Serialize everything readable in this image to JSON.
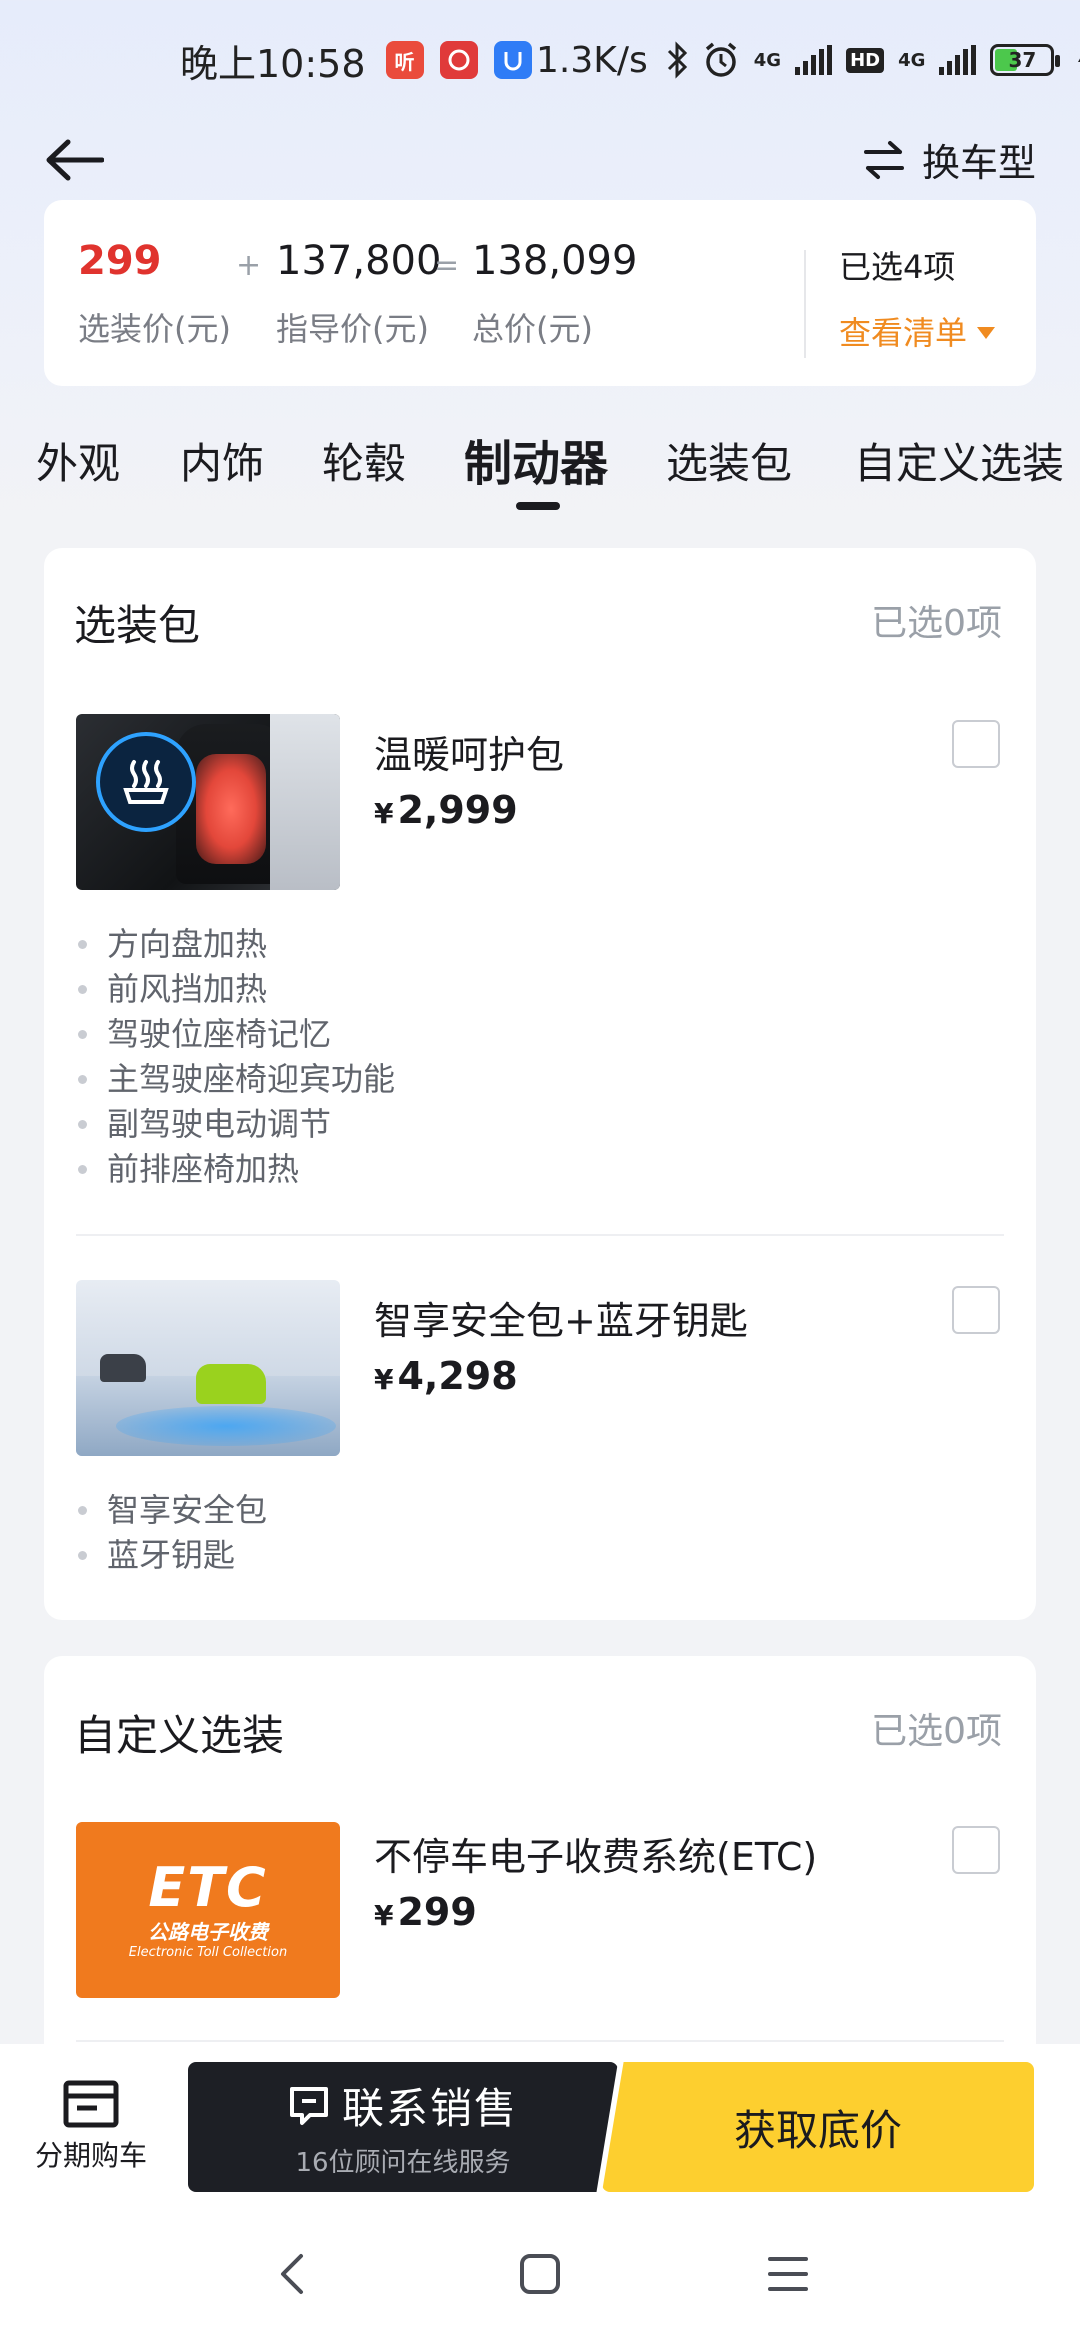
{
  "status_bar": {
    "time": "晚上10:58",
    "network_speed": "1.3K/s",
    "battery": "37",
    "net_tag_1": "4G",
    "net_tag_2": "HD",
    "net_tag_3": "4G",
    "app_icon_1": "听"
  },
  "header": {
    "switch_label": "换车型"
  },
  "price_summary": {
    "option_price": "299",
    "option_price_label": "选装价(元)",
    "plus": "+",
    "guide_price": "137,800",
    "guide_price_label": "指导价(元)",
    "equals": "=",
    "total_price": "138,099",
    "total_price_label": "总价(元)",
    "selected_count": "已选4项",
    "view_list": "查看清单"
  },
  "tabs": [
    {
      "label": "外观",
      "active": false
    },
    {
      "label": "内饰",
      "active": false
    },
    {
      "label": "轮毂",
      "active": false
    },
    {
      "label": "制动器",
      "active": true
    },
    {
      "label": "选装包",
      "active": false
    },
    {
      "label": "自定义选装",
      "active": false
    }
  ],
  "option_packages": {
    "title": "选装包",
    "selected": "已选0项",
    "items": [
      {
        "name": "温暖呵护包",
        "currency": "¥",
        "price": "2,999",
        "checked": false,
        "features": [
          "方向盘加热",
          "前风挡加热",
          "驾驶位座椅记忆",
          "主驾驶座椅迎宾功能",
          "副驾驶电动调节",
          "前排座椅加热"
        ]
      },
      {
        "name": "智享安全包+蓝牙钥匙",
        "currency": "¥",
        "price": "4,298",
        "checked": false,
        "features": [
          "智享安全包",
          "蓝牙钥匙"
        ]
      }
    ]
  },
  "custom_options": {
    "title": "自定义选装",
    "selected": "已选0项",
    "items": [
      {
        "name": "不停车电子收费系统(ETC)",
        "currency": "¥",
        "price": "299",
        "checked": false,
        "image_text": {
          "big": "ETC",
          "cn": "公路电子收费",
          "en": "Electronic Toll Collection"
        }
      }
    ]
  },
  "action_bar": {
    "installment_label": "分期购车",
    "contact_label": "联系销售",
    "contact_sub": "16位顾问在线服务",
    "lowest_price_label": "获取底价"
  },
  "colors": {
    "accent_orange": "#f08b20",
    "price_red": "#e0332e",
    "cta_yellow": "#fdcf2f",
    "cta_dark": "#1d1f25"
  },
  "icons": {
    "back": "arrow-left-icon",
    "switch": "swap-arrows-icon",
    "installment": "card-icon",
    "contact": "chat-icon",
    "nav_back": "chevron-left-icon",
    "nav_home": "square-icon",
    "nav_menu": "menu-icon"
  }
}
